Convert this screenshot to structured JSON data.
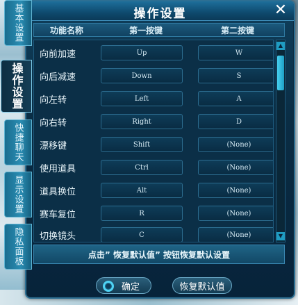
{
  "dialog": {
    "title": "操作设置",
    "close_label": "✕",
    "tabs": [
      {
        "label": "基本设置",
        "active": false
      },
      {
        "label": "操作设置",
        "active": true
      },
      {
        "label": "快捷聊天",
        "active": false
      },
      {
        "label": "显示设置",
        "active": false
      },
      {
        "label": "隐私面板",
        "active": false
      }
    ],
    "columns": {
      "name": "功能名称",
      "primary": "第一按键",
      "secondary": "第二按键"
    },
    "rows": [
      {
        "name": "向前加速",
        "primary": "Up",
        "secondary": "W"
      },
      {
        "name": "向后减速",
        "primary": "Down",
        "secondary": "S"
      },
      {
        "name": "向左转",
        "primary": "Left",
        "secondary": "A"
      },
      {
        "name": "向右转",
        "primary": "Right",
        "secondary": "D"
      },
      {
        "name": "漂移键",
        "primary": "Shift",
        "secondary": "(None)"
      },
      {
        "name": "使用道具",
        "primary": "Ctrl",
        "secondary": "(None)"
      },
      {
        "name": "道具换位",
        "primary": "Alt",
        "secondary": "(None)"
      },
      {
        "name": "赛车复位",
        "primary": "R",
        "secondary": "(None)"
      },
      {
        "name": "切换镜头",
        "primary": "C",
        "secondary": "(None)"
      }
    ],
    "hint": "点击” 恢复默认值” 按钮恢复默认设置",
    "buttons": {
      "ok": "确定",
      "reset": "恢复默认值"
    },
    "scrollbar": {
      "up_arrow": "▲",
      "down_arrow": "▼"
    }
  }
}
